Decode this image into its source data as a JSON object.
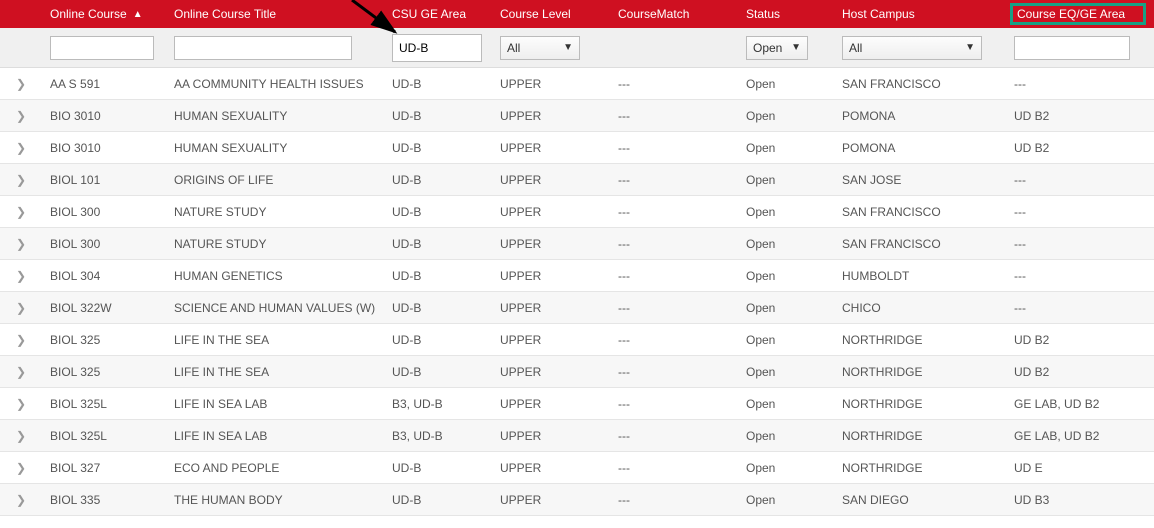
{
  "headers": {
    "expand": "",
    "course": "Online Course",
    "title": "Online Course Title",
    "ge": "CSU GE Area",
    "level": "Course Level",
    "match": "CourseMatch",
    "status": "Status",
    "host": "Host Campus",
    "eq": "Course EQ/GE Area",
    "sort_asc": "▲"
  },
  "filters": {
    "course": "",
    "title": "",
    "ge": "UD-B",
    "level": "All",
    "match": "",
    "status": "Open",
    "host": "All",
    "eq": ""
  },
  "rows": [
    {
      "course": "AA S 591",
      "title": "AA COMMUNITY HEALTH ISSUES",
      "ge": "UD-B",
      "level": "UPPER",
      "match": "---",
      "status": "Open",
      "host": "SAN FRANCISCO",
      "eq": "---"
    },
    {
      "course": "BIO 3010",
      "title": "HUMAN SEXUALITY",
      "ge": "UD-B",
      "level": "UPPER",
      "match": "---",
      "status": "Open",
      "host": "POMONA",
      "eq": "UD B2"
    },
    {
      "course": "BIO 3010",
      "title": "HUMAN SEXUALITY",
      "ge": "UD-B",
      "level": "UPPER",
      "match": "---",
      "status": "Open",
      "host": "POMONA",
      "eq": "UD B2"
    },
    {
      "course": "BIOL 101",
      "title": "ORIGINS OF LIFE",
      "ge": "UD-B",
      "level": "UPPER",
      "match": "---",
      "status": "Open",
      "host": "SAN JOSE",
      "eq": "---"
    },
    {
      "course": "BIOL 300",
      "title": "NATURE STUDY",
      "ge": "UD-B",
      "level": "UPPER",
      "match": "---",
      "status": "Open",
      "host": "SAN FRANCISCO",
      "eq": "---"
    },
    {
      "course": "BIOL 300",
      "title": "NATURE STUDY",
      "ge": "UD-B",
      "level": "UPPER",
      "match": "---",
      "status": "Open",
      "host": "SAN FRANCISCO",
      "eq": "---"
    },
    {
      "course": "BIOL 304",
      "title": "HUMAN GENETICS",
      "ge": "UD-B",
      "level": "UPPER",
      "match": "---",
      "status": "Open",
      "host": "HUMBOLDT",
      "eq": "---"
    },
    {
      "course": "BIOL 322W",
      "title": "SCIENCE AND HUMAN VALUES (W)",
      "ge": "UD-B",
      "level": "UPPER",
      "match": "---",
      "status": "Open",
      "host": "CHICO",
      "eq": "---"
    },
    {
      "course": "BIOL 325",
      "title": "LIFE IN THE SEA",
      "ge": "UD-B",
      "level": "UPPER",
      "match": "---",
      "status": "Open",
      "host": "NORTHRIDGE",
      "eq": "UD B2"
    },
    {
      "course": "BIOL 325",
      "title": "LIFE IN THE SEA",
      "ge": "UD-B",
      "level": "UPPER",
      "match": "---",
      "status": "Open",
      "host": "NORTHRIDGE",
      "eq": "UD B2"
    },
    {
      "course": "BIOL 325L",
      "title": "LIFE IN SEA LAB",
      "ge": "B3, UD-B",
      "level": "UPPER",
      "match": "---",
      "status": "Open",
      "host": "NORTHRIDGE",
      "eq": "GE LAB, UD B2"
    },
    {
      "course": "BIOL 325L",
      "title": "LIFE IN SEA LAB",
      "ge": "B3, UD-B",
      "level": "UPPER",
      "match": "---",
      "status": "Open",
      "host": "NORTHRIDGE",
      "eq": "GE LAB, UD B2"
    },
    {
      "course": "BIOL 327",
      "title": "ECO AND PEOPLE",
      "ge": "UD-B",
      "level": "UPPER",
      "match": "---",
      "status": "Open",
      "host": "NORTHRIDGE",
      "eq": "UD E"
    },
    {
      "course": "BIOL 335",
      "title": "THE HUMAN BODY",
      "ge": "UD-B",
      "level": "UPPER",
      "match": "---",
      "status": "Open",
      "host": "SAN DIEGO",
      "eq": "UD B3"
    }
  ],
  "icons": {
    "chevron_right": "❯",
    "caret_down": "▼"
  }
}
